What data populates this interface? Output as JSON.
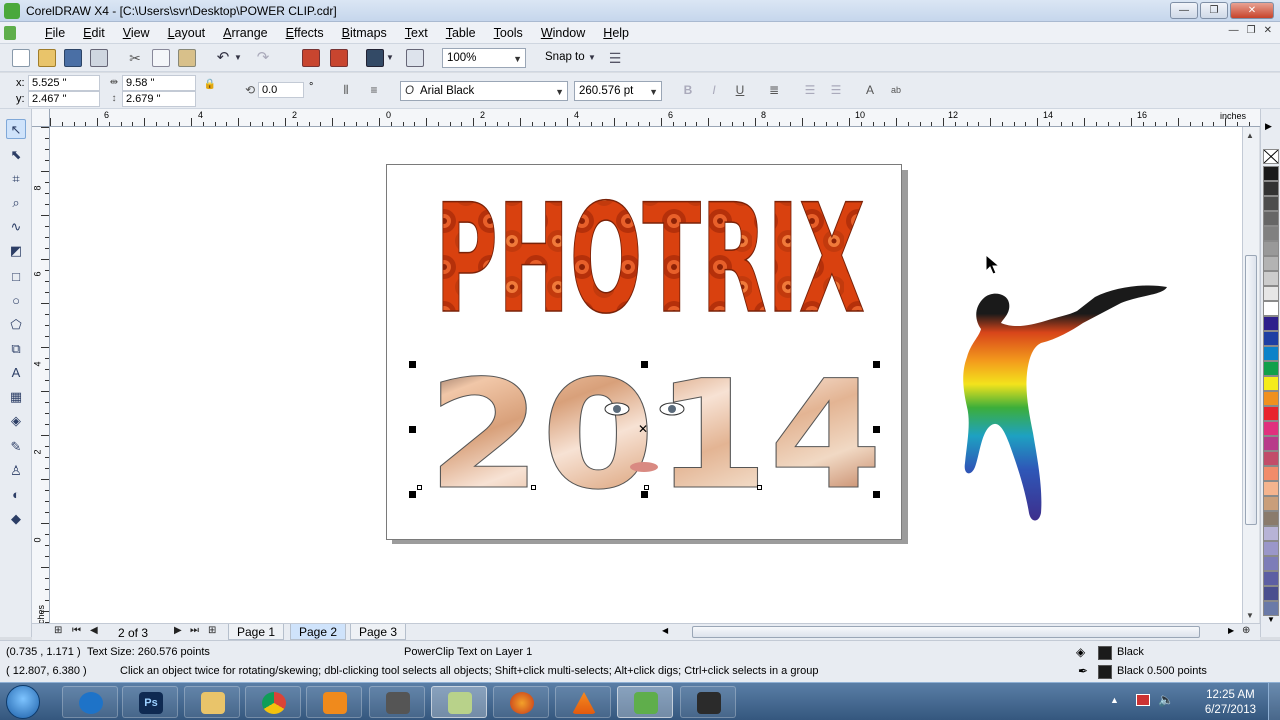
{
  "window": {
    "title": "CorelDRAW X4 - [C:\\Users\\svr\\Desktop\\POWER CLIP.cdr]",
    "minimize": "—",
    "maximize": "❐",
    "close": "✕"
  },
  "menu": [
    {
      "key": "F",
      "rest": "ile"
    },
    {
      "key": "E",
      "rest": "dit"
    },
    {
      "key": "V",
      "rest": "iew"
    },
    {
      "key": "L",
      "rest": "ayout"
    },
    {
      "key": "A",
      "rest": "rrange"
    },
    {
      "key": "E",
      "rest": "ffects"
    },
    {
      "key": "B",
      "rest": "itmaps"
    },
    {
      "key": "T",
      "rest": "ext"
    },
    {
      "key": "T",
      "rest": "able"
    },
    {
      "key": "T",
      "rest": "ools"
    },
    {
      "key": "W",
      "rest": "indow"
    },
    {
      "key": "H",
      "rest": "elp"
    }
  ],
  "toolbar": {
    "zoom": "100%",
    "snap_to": "Snap to"
  },
  "propbar": {
    "x_label": "x:",
    "x_value": "5.525 \"",
    "y_label": "y:",
    "y_value": "2.467 \"",
    "width_value": "9.58 \"",
    "height_value": "2.679 \"",
    "rotation_value": "0.0",
    "rotation_unit": "°",
    "font_name": "Arial Black",
    "font_size": "260.576 pt"
  },
  "ruler": {
    "unit": "inches",
    "v_unit": "inches",
    "h_ticks": [
      "6",
      "4",
      "2",
      "0",
      "2",
      "4",
      "6",
      "8",
      "10",
      "12",
      "14",
      "16"
    ],
    "v_ticks": [
      "8",
      "6",
      "4",
      "2",
      "0"
    ]
  },
  "artwork": {
    "headline": "PHOTRIX",
    "year": "2014"
  },
  "pagenav": {
    "count": "2 of 3",
    "tabs": [
      "Page 1",
      "Page 2",
      "Page 3"
    ],
    "active_tab": "Page 2"
  },
  "status": {
    "coords1": "(0.735 , 1.171 )",
    "text_size": "Text Size: 260.576 points",
    "layer_info": "PowerClip Text on Layer 1",
    "coords2": "( 12.807, 6.380 )",
    "hint": "Click an object twice for rotating/skewing; dbl-clicking tool selects all objects; Shift+click multi-selects; Alt+click digs; Ctrl+click selects in a group",
    "fill_label": "Black",
    "outline_label": "Black  0.500 points"
  },
  "taskbar": {
    "time": "12:25 AM",
    "date": "6/27/2013"
  },
  "palette_colors": [
    "#1a1a1a",
    "#333333",
    "#4d4d4d",
    "#666666",
    "#808080",
    "#999999",
    "#b3b3b3",
    "#cccccc",
    "#e6e6e6",
    "#ffffff",
    "#2e1f8c",
    "#1e3fa3",
    "#0b82c9",
    "#12a04a",
    "#f5ec1a",
    "#f0901e",
    "#e8242d",
    "#e0307e",
    "#b83a8a",
    "#c24d6a",
    "#f18b6a",
    "#f5b48e",
    "#c99e7a",
    "#8a7b6c",
    "#b7b3d6",
    "#9a97c9",
    "#7d7db8",
    "#5d5fa3",
    "#4a4f8f",
    "#6a7aa8"
  ]
}
